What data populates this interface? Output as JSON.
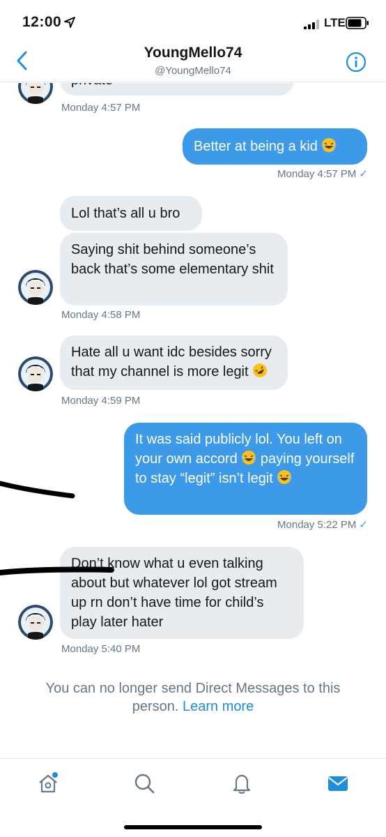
{
  "status_bar": {
    "time": "12:00",
    "network": "LTE"
  },
  "header": {
    "name": "YoungMello74",
    "handle": "@YoungMello74"
  },
  "messages": [
    {
      "direction": "in",
      "text": "private",
      "time": "Monday 4:57 PM"
    },
    {
      "direction": "out",
      "text": "Better at being a kid",
      "emoji": "😂",
      "time": "Monday 4:57 PM"
    },
    {
      "direction": "in",
      "text": "Lol that’s all u bro"
    },
    {
      "direction": "in",
      "text": "Saying shit behind someone’s back that’s some elementary shit",
      "time": "Monday 4:58 PM"
    },
    {
      "direction": "in",
      "text": "Hate all u want idc besides sorry that my channel is more legit",
      "emoji": "🤣",
      "time": "Monday 4:59 PM"
    },
    {
      "direction": "out",
      "text_parts": [
        "It was said publicly lol. You left on your own accord",
        "paying yourself to stay “legit” isn’t legit"
      ],
      "time": "Monday 5:22 PM"
    },
    {
      "direction": "in",
      "text": "Don’t know what u even talking about but whatever lol got stream up rn don’t have time for child’s play later hater",
      "time": "Monday 5:40 PM"
    }
  ],
  "notice": {
    "text": "You can no longer send Direct Messages to this person.",
    "link": "Learn more"
  },
  "tabs": [
    {
      "name": "home-icon"
    },
    {
      "name": "search-icon"
    },
    {
      "name": "notifications-icon"
    },
    {
      "name": "messages-icon"
    }
  ],
  "colors": {
    "accent": "#1d8ddc",
    "outgoing_bubble": "#3d9ae8",
    "incoming_bubble": "#e6ecf0",
    "meta_text": "#657786"
  }
}
